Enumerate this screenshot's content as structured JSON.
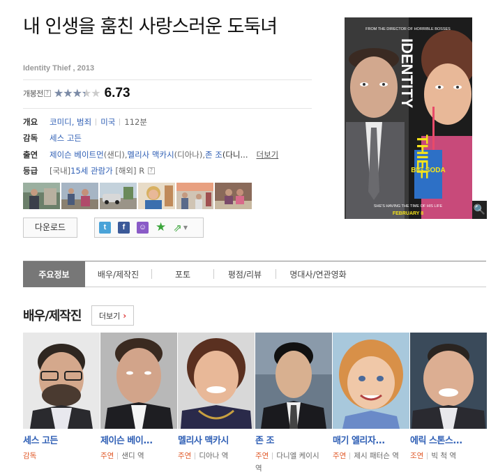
{
  "movie": {
    "title": "내 인생을 훔친 사랑스러운 도둑녀",
    "subtitle": "Identity Thief , 2013",
    "rating_label": "개봉전",
    "rating_help": "?",
    "rating_score": "6.73",
    "rating_fraction": 0.673
  },
  "info": {
    "summary_label": "개요",
    "genres": "코미디, 범죄",
    "country": "미국",
    "runtime": "112분",
    "director_label": "감독",
    "director": "세스 고든",
    "cast_label": "출연",
    "cast_1_name": "제이슨 베이트먼",
    "cast_1_role": "(샌디), ",
    "cast_2_name": "멜리사 맥카시",
    "cast_2_role": "(디아나), ",
    "cast_3_name": "존 조",
    "cast_3_role": "(다니...",
    "more_label": "더보기",
    "grade_label": "등급",
    "grade_domestic_prefix": "[국내] ",
    "grade_domestic": "15세 관람가",
    "grade_overseas": " [해외] R ",
    "grade_help": "?"
  },
  "actions": {
    "download_label": "다운로드",
    "twitter_glyph": "t",
    "facebook_glyph": "f",
    "chat_glyph": "☺",
    "star_glyph": "★",
    "more_glyph": "⇗",
    "dropdown_glyph": "▼"
  },
  "poster": {
    "top_text": "FROM THE DIRECTOR OF HORRIBLE BOSSES",
    "title_1": "IDENTITY",
    "title_2": "THIEF",
    "tagline": "SHE'S HAVING THE TIME OF HIS LIFE",
    "date": "FEBRUARY 8",
    "cup_text": "BIG SODA",
    "zoom_glyph": "🔍"
  },
  "tabs": [
    {
      "label": "주요정보"
    },
    {
      "label": "배우/제작진"
    },
    {
      "label": "포토"
    },
    {
      "label": "평점/리뷰"
    },
    {
      "label": "명대사/연관영화"
    }
  ],
  "section": {
    "title": "배우/제작진",
    "more_label": "더보기",
    "more_glyph": "›"
  },
  "cast": [
    {
      "name": "세스 고든",
      "role_type": "감독",
      "role": ""
    },
    {
      "name": "제이슨 베이...",
      "role_type": "주연",
      "role": "샌디 역"
    },
    {
      "name": "멜리사 맥카시",
      "role_type": "주연",
      "role": "디아나 역"
    },
    {
      "name": "존 조",
      "role_type": "주연",
      "role": "다니엘 케이시 역"
    },
    {
      "name": "매기 엘리자...",
      "role_type": "주연",
      "role": "제시 패터슨 역"
    },
    {
      "name": "에릭 스톤스...",
      "role_type": "조연",
      "role": "빅 척 역"
    }
  ],
  "colors": {
    "link": "#2f5fb5",
    "role_accent": "#e05a2a",
    "active_tab": "#777777",
    "poster_title": "#f5e31a"
  }
}
